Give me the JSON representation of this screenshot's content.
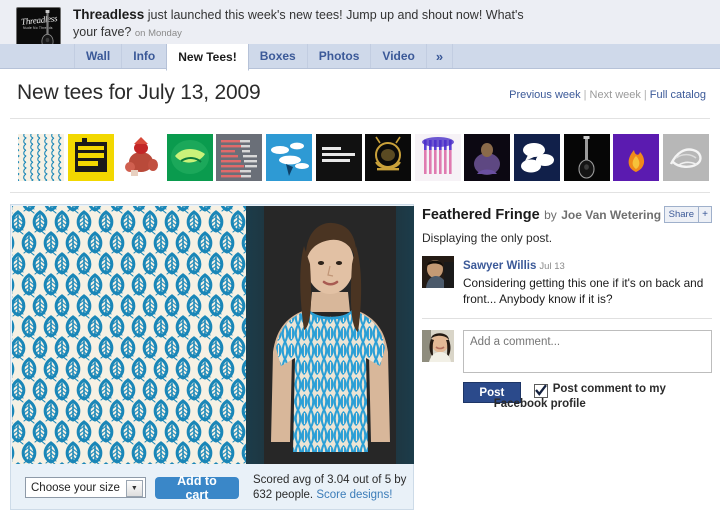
{
  "post_header": {
    "brand": "Threadless",
    "message": "just launched this week's new tees! Jump up and shout now! What's your fave?",
    "timestamp": "on Monday",
    "avatar_alt": "threadless-guitar-logo"
  },
  "tabs": [
    {
      "label": "Wall",
      "active": false
    },
    {
      "label": "Info",
      "active": false
    },
    {
      "label": "New Tees!",
      "active": true
    },
    {
      "label": "Boxes",
      "active": false
    },
    {
      "label": "Photos",
      "active": false
    },
    {
      "label": "Video",
      "active": false
    },
    {
      "label": "»",
      "active": false
    }
  ],
  "page": {
    "title": "New tees for July 13, 2009",
    "nav": {
      "previous": "Previous week",
      "next": "Next week",
      "catalog": "Full catalog",
      "separator": "|"
    }
  },
  "thumbnails": [
    {
      "name": "feathered-fringe",
      "style": "feather",
      "bg": "#f6f1e4",
      "ink": "#1a87b8",
      "selected": true
    },
    {
      "name": "yellow-building",
      "style": "blocky",
      "bg": "#f2d800",
      "ink": "#1a1a1a",
      "selected": false
    },
    {
      "name": "red-squirrel-rider",
      "style": "figure",
      "bg": "#ffffff",
      "ink": "#c32626",
      "selected": false
    },
    {
      "name": "green-globe",
      "style": "organic",
      "bg": "#0a9b4e",
      "ink": "#caf27a",
      "selected": false
    },
    {
      "name": "grey-lines",
      "style": "stripes",
      "bg": "#6a6f78",
      "ink": "#d8d8d8",
      "selected": false
    },
    {
      "name": "blue-clouds",
      "style": "clouds",
      "bg": "#2e9ad4",
      "ink": "#ffffff",
      "selected": false
    },
    {
      "name": "oldest-ive-ever-been",
      "style": "text",
      "bg": "#111111",
      "ink": "#e8e8e8",
      "selected": false
    },
    {
      "name": "gold-crest",
      "style": "crest",
      "bg": "#0a0a0a",
      "ink": "#c9a13a",
      "selected": false
    },
    {
      "name": "pink-columns",
      "style": "columns",
      "bg": "#f0eef2",
      "ink": "#e07ab0",
      "selected": false
    },
    {
      "name": "purple-figure",
      "style": "figure",
      "bg": "#0c0812",
      "ink": "#7a5ea8",
      "selected": false
    },
    {
      "name": "navy-speech-bubbles",
      "style": "bubbles",
      "bg": "#11204a",
      "ink": "#ffffff",
      "selected": false
    },
    {
      "name": "black-guitar",
      "style": "guitar",
      "bg": "#060606",
      "ink": "#9b9b9b",
      "selected": false
    },
    {
      "name": "purple-flame",
      "style": "flame",
      "bg": "#5b1bb0",
      "ink": "#f08a1a",
      "selected": false
    },
    {
      "name": "grey-scribble",
      "style": "scribble",
      "bg": "#b7b7b7",
      "ink": "#f0f0f0",
      "selected": false
    }
  ],
  "product": {
    "design_title": "Feathered Fringe",
    "by_label": "by",
    "author": "Joe Van Wetering",
    "share_label": "Share",
    "share_plus": "+",
    "size_selector_value": "Choose your size",
    "add_to_cart_label": "Add to cart",
    "score_text_line1": "Scored avg of 3.04 out of 5 by",
    "score_text_line2": "632 people.",
    "score_link": "Score designs!",
    "score_average": "3.04",
    "score_max": "5",
    "score_count": "632",
    "design_colors": {
      "background": "#f6f1e4",
      "ink": "#1a87b8"
    }
  },
  "comments": {
    "displaying_text": "Displaying the only post.",
    "items": [
      {
        "author": "Sawyer Willis",
        "date": "Jul 13",
        "text": "Considering getting this one if it's on back and front... Anybody know if it is?"
      }
    ],
    "composer": {
      "placeholder": "Add a comment...",
      "value": "",
      "post_label": "Post",
      "checkbox_checked": true,
      "checkbox_label_line1": "Post comment to my",
      "checkbox_label_line2": "Facebook profile"
    }
  },
  "colors": {
    "facebook_blue": "#3b5998",
    "tab_bar": "#cfd9ea",
    "header_bg": "#eceef4",
    "panel_bg": "#e9f1f8",
    "accent_button": "#3a87c8",
    "post_button": "#2b4a8b"
  }
}
